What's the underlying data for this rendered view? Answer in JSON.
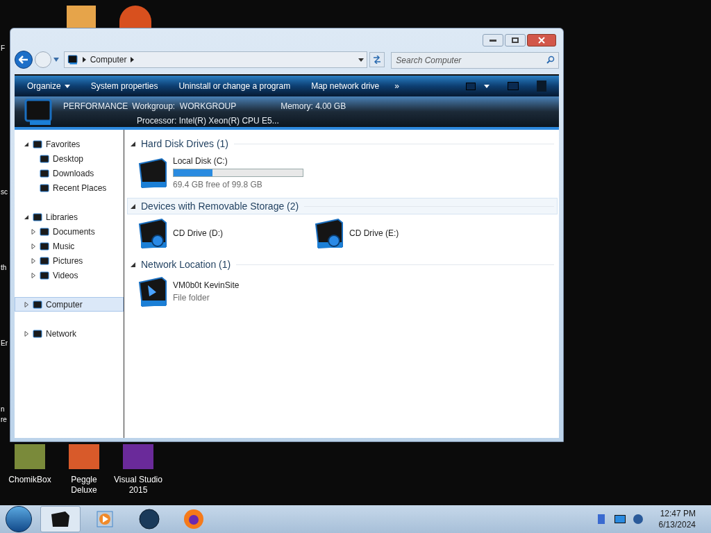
{
  "desktop": {
    "edge_labels": [
      "F",
      "sc",
      "th",
      "Er",
      "n",
      "re"
    ],
    "icons": [
      {
        "label": "ChomikBox"
      },
      {
        "label": "Peggle Deluxe"
      },
      {
        "label": "Visual Studio 2015"
      }
    ]
  },
  "window": {
    "address": {
      "crumbs": [
        "Computer"
      ]
    },
    "search": {
      "placeholder": "Search Computer"
    },
    "toolbar": {
      "items": [
        {
          "label": "Organize",
          "dropdown": true
        },
        {
          "label": "System properties",
          "dropdown": false
        },
        {
          "label": "Uninstall or change a program",
          "dropdown": false
        },
        {
          "label": "Map network drive",
          "dropdown": false
        }
      ],
      "more": "»"
    },
    "details": {
      "name": "PERFORMANCE",
      "workgroup": "Workgroup:  WORKGROUP",
      "memory": "Memory: 4.00 GB",
      "processor": "Processor: Intel(R) Xeon(R) CPU E5..."
    },
    "nav": [
      {
        "label": "Favorites",
        "expanded": true,
        "selected": false,
        "children": [
          {
            "label": "Desktop"
          },
          {
            "label": "Downloads"
          },
          {
            "label": "Recent Places"
          }
        ]
      },
      {
        "label": "Libraries",
        "expanded": true,
        "selected": false,
        "children": [
          {
            "label": "Documents",
            "expanded": false
          },
          {
            "label": "Music",
            "expanded": false
          },
          {
            "label": "Pictures",
            "expanded": false
          },
          {
            "label": "Videos",
            "expanded": false
          }
        ]
      },
      {
        "label": "Computer",
        "expanded": false,
        "selected": true
      },
      {
        "label": "Network",
        "expanded": false,
        "selected": false
      }
    ],
    "groups": [
      {
        "title": "Hard Disk Drives (1)",
        "hovered": false,
        "items": [
          {
            "kind": "disk",
            "name": "Local Disk (C:)",
            "level": 0.3,
            "info": "69.4 GB free of 99.8 GB"
          }
        ]
      },
      {
        "title": "Devices with Removable Storage (2)",
        "hovered": true,
        "items": [
          {
            "kind": "drive",
            "name": "CD Drive (D:)"
          },
          {
            "kind": "drive",
            "name": "CD Drive (E:)"
          }
        ]
      },
      {
        "title": "Network Location (1)",
        "hovered": false,
        "items": [
          {
            "kind": "folder",
            "name": "VM0b0t KevinSite",
            "info": "File folder"
          }
        ]
      }
    ]
  },
  "taskbar": {
    "tasks": [
      {
        "kind": "explorer",
        "selected": true
      },
      {
        "kind": "media",
        "selected": false
      },
      {
        "kind": "globe",
        "selected": false
      },
      {
        "kind": "firefox",
        "selected": false
      }
    ],
    "time": "12:47 PM",
    "date": "6/13/2024"
  }
}
